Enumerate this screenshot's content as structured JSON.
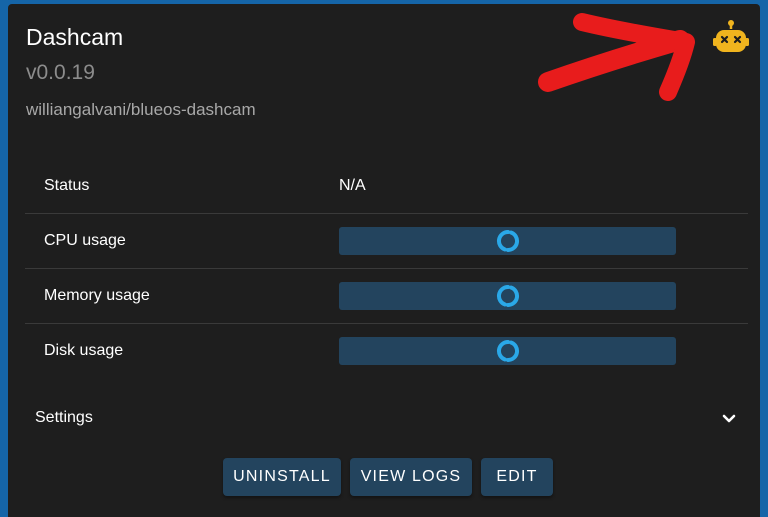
{
  "extension": {
    "name": "Dashcam",
    "version": "v0.0.19",
    "repository": "williangalvani/blueos-dashcam",
    "status_icon": "robot-dead-icon",
    "status_icon_color": "#f0b41e"
  },
  "stats": [
    {
      "label": "Status",
      "value": "N/A"
    },
    {
      "label": "CPU usage",
      "loading": true
    },
    {
      "label": "Memory usage",
      "loading": true
    },
    {
      "label": "Disk usage",
      "loading": true
    }
  ],
  "settings": {
    "label": "Settings",
    "icon": "chevron-down-icon"
  },
  "actions": {
    "uninstall_label": "UNINSTALL",
    "view_logs_label": "VIEW LOGS",
    "edit_label": "EDIT"
  },
  "annotation": {
    "color": "#e81c1c"
  },
  "colors": {
    "card_background": "#1e1e1e",
    "page_background": "#1565a8",
    "button_background": "#23445e",
    "spinner": "#2aa8e8"
  }
}
